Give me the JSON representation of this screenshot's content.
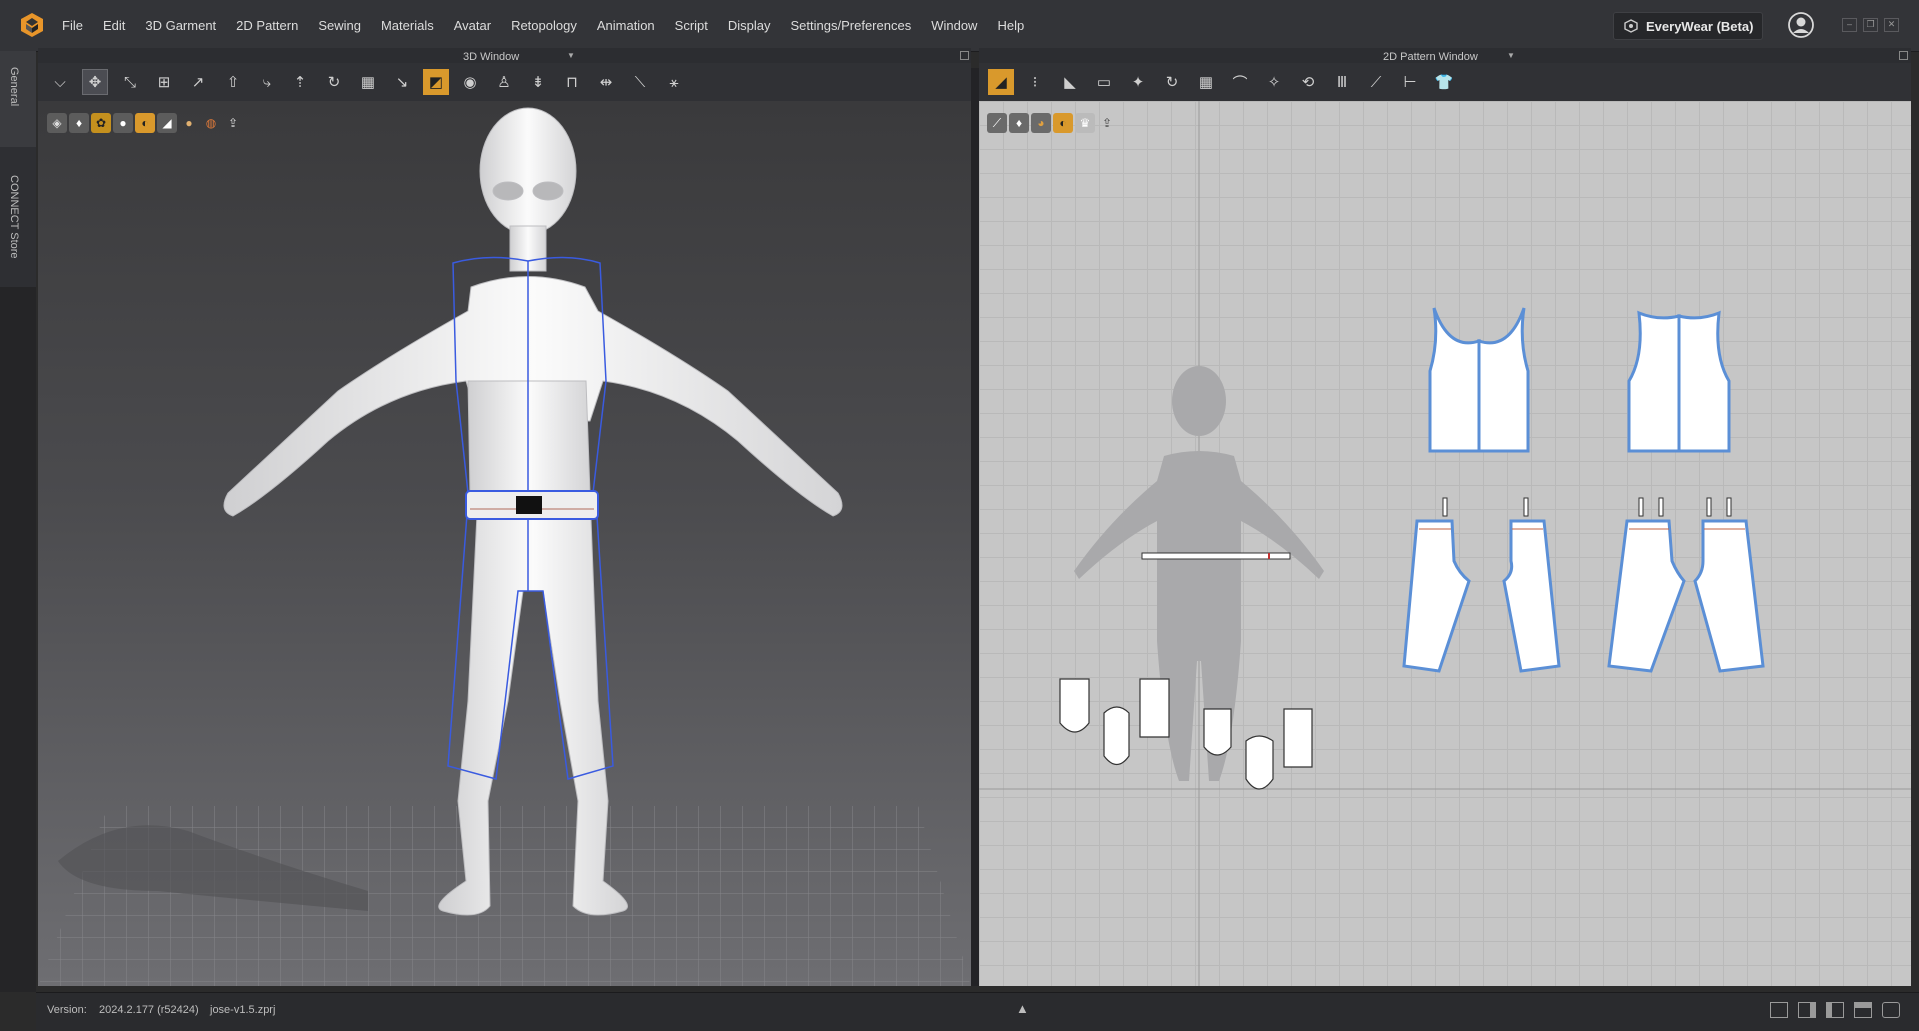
{
  "app": {
    "logo": "marvelous-logo-icon",
    "accent": "#e8952a"
  },
  "menu": [
    "File",
    "Edit",
    "3D Garment",
    "2D Pattern",
    "Sewing",
    "Materials",
    "Avatar",
    "Retopology",
    "Animation",
    "Script",
    "Display",
    "Settings/Preferences",
    "Window",
    "Help"
  ],
  "workspace": {
    "label": "EveryWear (Beta)"
  },
  "side_tabs": {
    "general": "General",
    "store": "CONNECT Store"
  },
  "panels": {
    "left_title": "3D Window",
    "right_title": "2D Pattern Window"
  },
  "status": {
    "version_label": "Version:",
    "version": "2024.2.177 (r52424)",
    "file": "jose-v1.5.zprj"
  },
  "colors": {
    "panel_bg": "#2b2b2b",
    "viewport_2d": "#c6c6c6",
    "pattern_outline": "#5b8fd6",
    "seam": "#3a5be0"
  }
}
